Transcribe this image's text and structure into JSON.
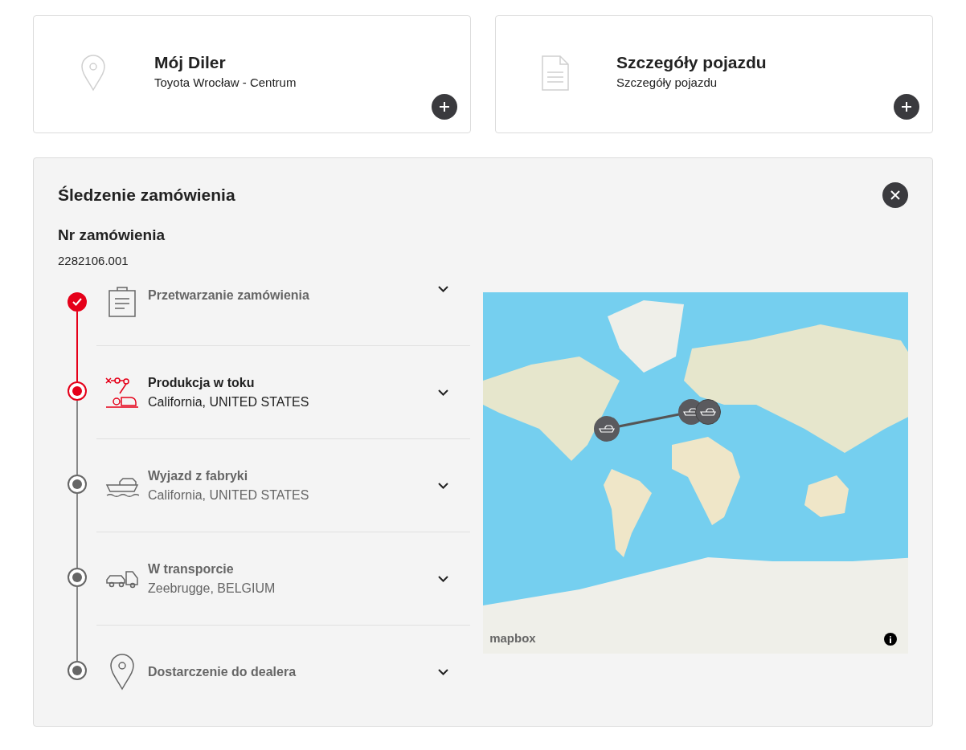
{
  "cards": [
    {
      "title": "Mój Diler",
      "subtitle": "Toyota Wrocław - Centrum"
    },
    {
      "title": "Szczegóły pojazdu",
      "subtitle": "Szczegóły pojazdu"
    }
  ],
  "tracking": {
    "title": "Śledzenie zamówienia",
    "order_label": "Nr zamówienia",
    "order_number": "2282106.001",
    "steps": [
      {
        "kind": "done",
        "title": "Przetwarzanie zamówienia"
      },
      {
        "kind": "current",
        "title": "Produkcja w toku",
        "location": "California, UNITED STATES"
      },
      {
        "kind": "pending",
        "title": "Wyjazd z fabryki",
        "location": "California, UNITED STATES"
      },
      {
        "kind": "pending",
        "title": "W transporcie",
        "location": "Zeebrugge, BELGIUM"
      },
      {
        "kind": "pending",
        "title": "Dostarczenie do dealera"
      }
    ],
    "map": {
      "attribution": "mapbox"
    }
  }
}
